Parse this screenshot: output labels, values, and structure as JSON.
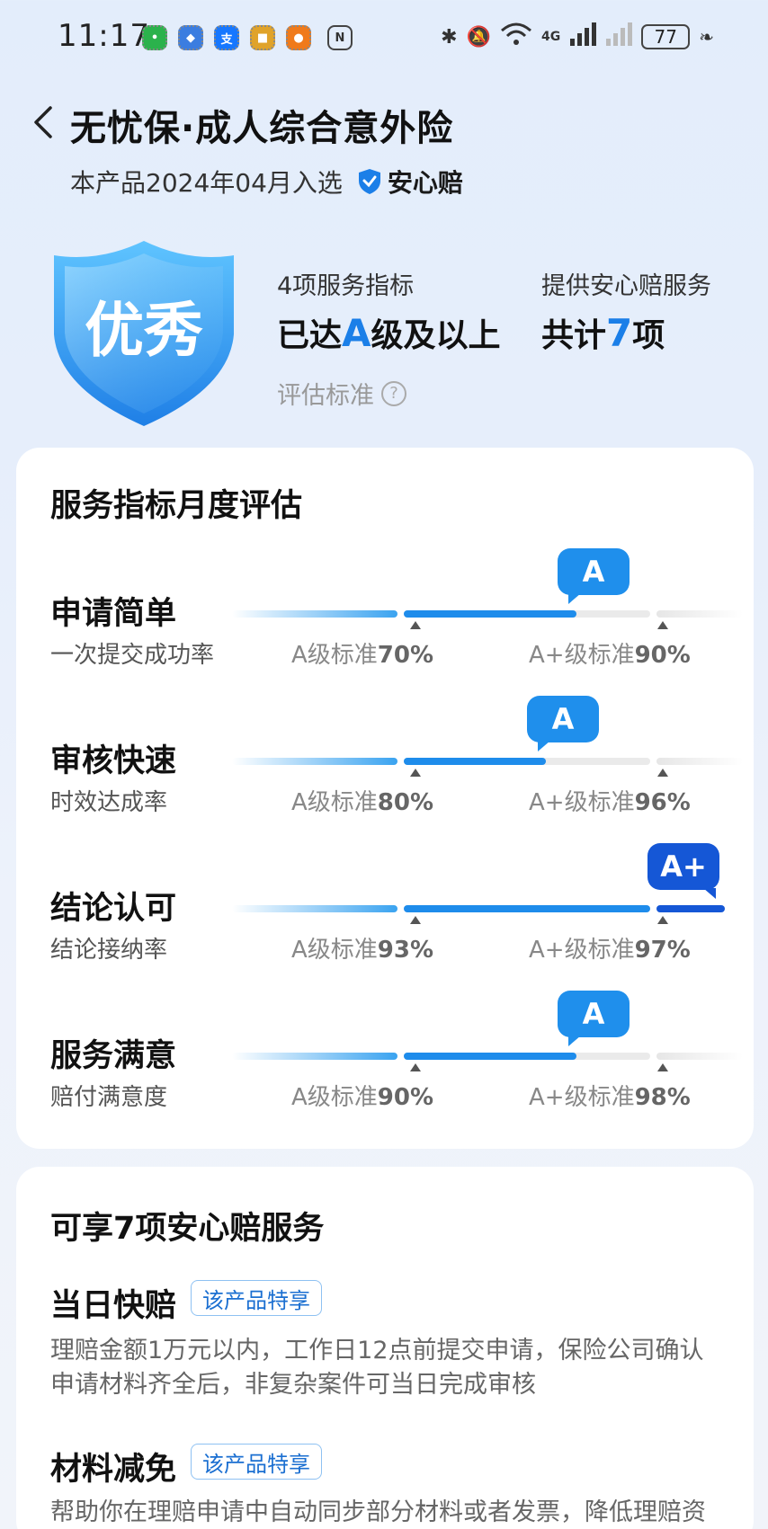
{
  "status_bar": {
    "time": "11:17",
    "apps": [
      "wechat",
      "shield",
      "alipay",
      "meituan",
      "taobao"
    ],
    "nfc_label": "N",
    "network": "4G",
    "battery": "77"
  },
  "header": {
    "title": "无忧保·成人综合意外险",
    "subtitle": "本产品2024年04月入选",
    "badge_label": "安心赔"
  },
  "hero": {
    "shield_text": "优秀",
    "stat1_label": "4项服务指标",
    "stat1_prefix": "已达",
    "stat1_grade": "A",
    "stat1_suffix": "级及以上",
    "stat2_label": "提供安心赔服务",
    "stat2_prefix": "共计",
    "stat2_count": "7",
    "stat2_suffix": "项",
    "eval_link": "评估标准",
    "help_glyph": "?"
  },
  "monthly_eval": {
    "title": "服务指标月度评估",
    "a_label": "A级标准",
    "aplus_label": "A+级标准",
    "metrics": [
      {
        "name": "申请简单",
        "sub": "一次提交成功率",
        "a_std": "70%",
        "aplus_std": "90%",
        "grade": "A",
        "progress": 0.7
      },
      {
        "name": "审核快速",
        "sub": "时效达成率",
        "a_std": "80%",
        "aplus_std": "96%",
        "grade": "A",
        "progress": 0.57
      },
      {
        "name": "结论认可",
        "sub": "结论接纳率",
        "a_std": "93%",
        "aplus_std": "97%",
        "grade": "A+",
        "progress": 1.0
      },
      {
        "name": "服务满意",
        "sub": "赔付满意度",
        "a_std": "90%",
        "aplus_std": "98%",
        "grade": "A",
        "progress": 0.7
      }
    ]
  },
  "services": {
    "title": "可享7项安心赔服务",
    "items": [
      {
        "name": "当日快赔",
        "tag": "该产品特享",
        "desc_line1": "理赔金额1万元以内，工作日12点前提交申请，保险公司确认",
        "desc_line2": "申请材料齐全后，非复杂案件可当日完成审核"
      },
      {
        "name": "材料减免",
        "tag": "该产品特享",
        "desc_line1": "帮助你在理赔申请中自动同步部分材料或者发票，降低理赔资",
        "desc_line2": ""
      }
    ]
  }
}
